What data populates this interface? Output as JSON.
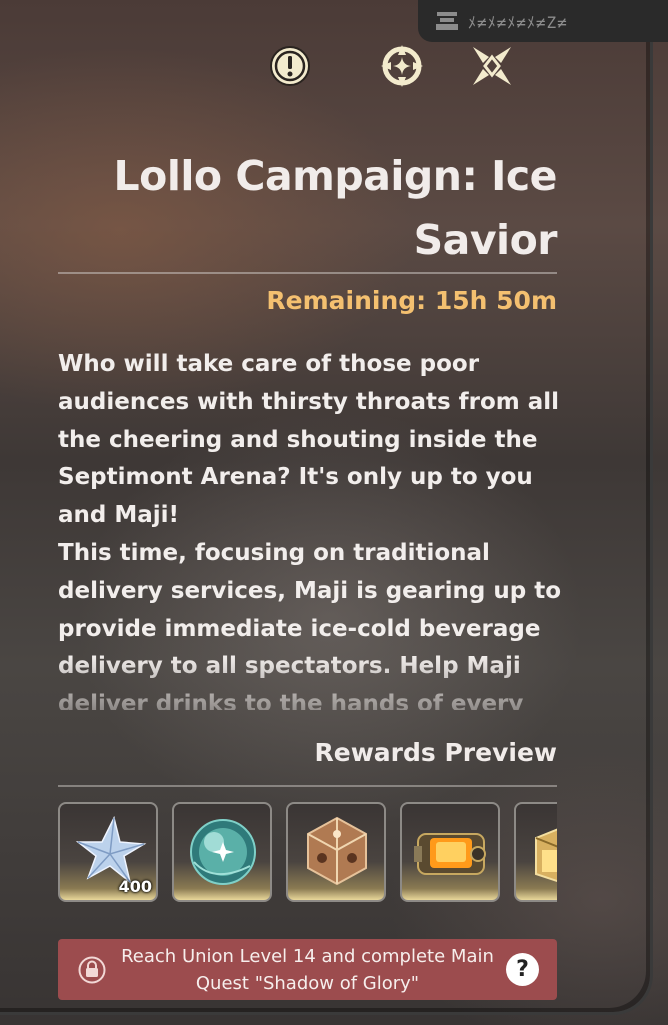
{
  "header": {
    "tab_code": "ﾒ≠ﾒ≠ﾒ≠ﾒ≠Z≠",
    "icons": [
      "alert-icon",
      "target-reticle-icon",
      "compass-cross-icon"
    ]
  },
  "event": {
    "title": "Lollo Campaign: Ice Savior",
    "remaining": "Remaining: 15h 50m",
    "description": [
      "Who will take care of those poor audiences with thirsty throats from all the cheering and shouting inside the Septimont Arena? It's only up to you and Maji!",
      "This time, focusing on traditional delivery services, Maji is gearing up to provide immediate ice-cold beverage delivery to all spectators. Help Maji deliver drinks to the hands of every"
    ]
  },
  "rewards": {
    "heading": "Rewards Preview",
    "items": [
      {
        "icon": "crystal-star-icon",
        "quantity": "400"
      },
      {
        "icon": "orb-icon",
        "quantity": ""
      },
      {
        "icon": "crystal-cube-icon",
        "quantity": ""
      },
      {
        "icon": "golden-chest-icon",
        "quantity": ""
      },
      {
        "icon": "gold-box-icon",
        "quantity": ""
      }
    ]
  },
  "unlock": {
    "requirement": "Reach Union Level 14 and complete Main Quest \"Shadow of Glory\"",
    "help_label": "?"
  },
  "colors": {
    "remaining": "#f4c070",
    "lock_bar": "#9c4c4e",
    "title": "#f1ecea"
  }
}
